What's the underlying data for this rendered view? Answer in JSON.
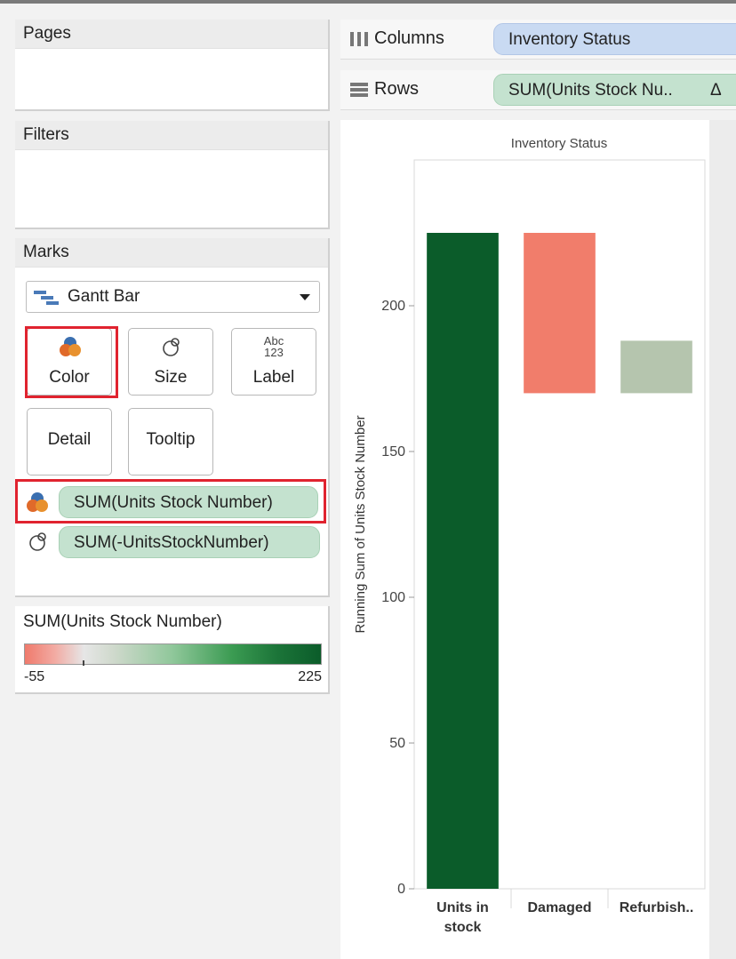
{
  "shelves": {
    "pages_title": "Pages",
    "filters_title": "Filters",
    "columns_label": "Columns",
    "columns_pill": "Inventory Status",
    "rows_label": "Rows",
    "rows_pill": "SUM(Units Stock Nu..",
    "rows_pill_delta": "Δ"
  },
  "marks": {
    "title": "Marks",
    "mark_type": "Gantt Bar",
    "buttons": {
      "color": "Color",
      "size": "Size",
      "label": "Label",
      "label_icon_top": "Abc",
      "label_icon_bottom": "123",
      "detail": "Detail",
      "tooltip": "Tooltip"
    },
    "fields": [
      {
        "label": "SUM(Units Stock Number)",
        "role": "color-icon"
      },
      {
        "label": "SUM(-UnitsStockNumber)",
        "role": "size-icon"
      }
    ]
  },
  "legend": {
    "title": "SUM(Units Stock Number)",
    "min_label": "-55",
    "max_label": "225",
    "colors": [
      "#ef7a6c",
      "#e6e6e6",
      "#0b5c2a"
    ]
  },
  "chart_data": {
    "type": "bar",
    "title": "Inventory Status",
    "ylabel": "Running Sum of Units Stock Number",
    "xlabel": "",
    "ylim": [
      0,
      250
    ],
    "yticks": [
      0,
      50,
      100,
      150,
      200
    ],
    "categories": [
      "Units in stock",
      "Damaged",
      "Refurbish.."
    ],
    "category_labels": [
      [
        "Units in",
        "stock"
      ],
      [
        "Damaged"
      ],
      [
        "Refurbish.."
      ]
    ],
    "bars": [
      {
        "category": "Units in stock",
        "start": 0,
        "end": 225,
        "color": "#0b5c2a"
      },
      {
        "category": "Damaged",
        "start": 170,
        "end": 225,
        "color": "#f17d6b"
      },
      {
        "category": "Refurbish..",
        "start": 170,
        "end": 188,
        "color": "#b5c5ae"
      }
    ]
  }
}
